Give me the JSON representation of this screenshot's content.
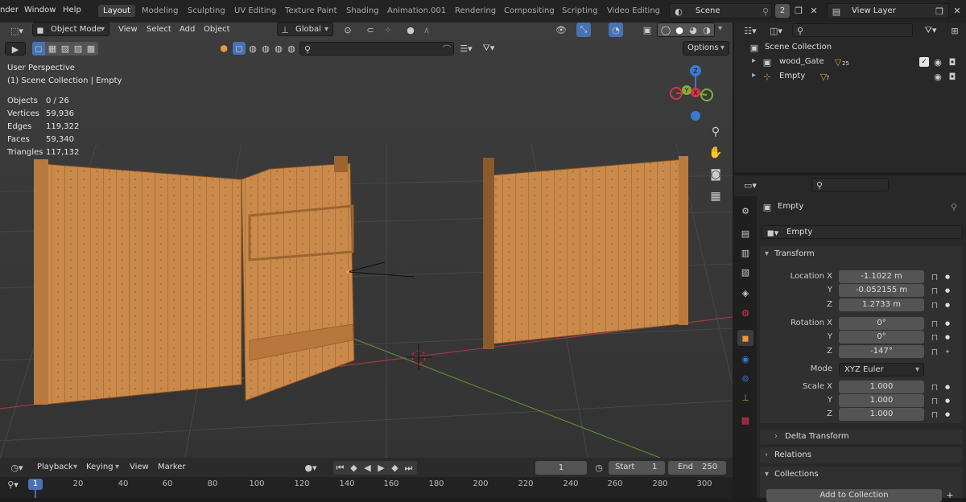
{
  "topbar": {
    "menus": [
      "nder",
      "Window",
      "Help"
    ],
    "workspaces": [
      "Layout",
      "Modeling",
      "Sculpting",
      "UV Editing",
      "Texture Paint",
      "Shading",
      "Animation.001",
      "Rendering",
      "Compositing",
      "Scripting",
      "Video Editing"
    ],
    "active_workspace": "Layout",
    "scene_name": "Scene",
    "scene_users": "2",
    "view_layer": "View Layer"
  },
  "viewport_header": {
    "mode": "Object Mode",
    "menus": [
      "View",
      "Select",
      "Add",
      "Object"
    ],
    "orientation": "Global",
    "options_label": "Options"
  },
  "overlay": {
    "perspective": "User Perspective",
    "collection": "(1) Scene Collection | Empty",
    "stats": [
      {
        "label": "Objects",
        "value": "0 / 26"
      },
      {
        "label": "Vertices",
        "value": "59,936"
      },
      {
        "label": "Edges",
        "value": "119,322"
      },
      {
        "label": "Faces",
        "value": "59,340"
      },
      {
        "label": "Triangles",
        "value": "117,132"
      }
    ]
  },
  "gizmo": {
    "x": "X",
    "y": "Y",
    "z": "Z"
  },
  "outliner": {
    "root": "Scene Collection",
    "items": [
      {
        "name": "wood_Gate",
        "badge": "25"
      },
      {
        "name": "Empty",
        "badge": "7"
      }
    ]
  },
  "properties": {
    "object_name": "Empty",
    "data_name": "Empty",
    "transform_label": "Transform",
    "location_label": "Location X",
    "location": {
      "x": "-1.1022 m",
      "y": "-0.052155 m",
      "z": "1.2733 m"
    },
    "rotation_label": "Rotation X",
    "rotation": {
      "x": "0°",
      "y": "0°",
      "z": "-147°"
    },
    "mode_label": "Mode",
    "mode_value": "XYZ Euler",
    "scale_label": "Scale X",
    "scale": {
      "x": "1.000",
      "y": "1.000",
      "z": "1.000"
    },
    "axis_y": "Y",
    "axis_z": "Z",
    "delta_transform": "Delta Transform",
    "relations": "Relations",
    "collections": "Collections",
    "add_to_collection": "Add to Collection"
  },
  "timeline": {
    "menus": [
      "Playback",
      "Keying",
      "View",
      "Marker"
    ],
    "current_frame": "1",
    "start_label": "Start",
    "start_value": "1",
    "end_label": "End",
    "end_value": "250",
    "ruler_current": "1",
    "ticks": [
      "20",
      "40",
      "60",
      "80",
      "100",
      "120",
      "140",
      "160",
      "180",
      "200",
      "220",
      "240",
      "260",
      "280",
      "300"
    ]
  },
  "colors": {
    "accent_blue": "#4772b3",
    "axis_x": "#d5344c",
    "axis_y": "#7cb233",
    "axis_z": "#3a79d1",
    "wood": "#c98a4b",
    "object_orange": "#e59b3b"
  }
}
